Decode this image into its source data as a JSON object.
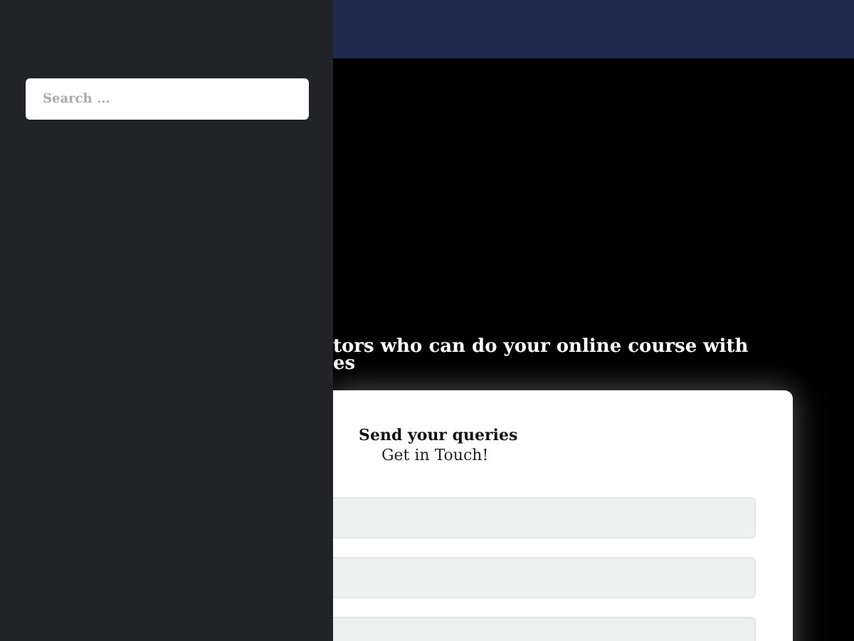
{
  "sidebar": {
    "search": {
      "placeholder": "Search ..."
    }
  },
  "hero": {
    "heading_lines": [
      "tors who can do your online course with",
      "es"
    ]
  },
  "contact_card": {
    "title": "Send your queries",
    "subtitle": "Get in Touch!",
    "fields": [
      {
        "kind": "text"
      },
      {
        "kind": "text"
      },
      {
        "kind": "text"
      }
    ]
  }
}
